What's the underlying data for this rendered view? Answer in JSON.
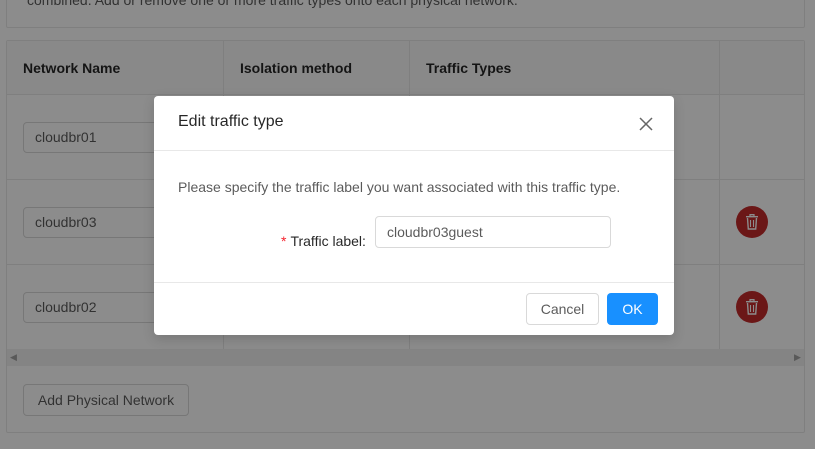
{
  "background": {
    "description": "combined. Add or remove one or more traffic types onto each physical network.",
    "table": {
      "headers": [
        "Network Name",
        "Isolation method",
        "Traffic Types",
        ""
      ],
      "rows": [
        {
          "network_name": "cloudbr01",
          "deletable": false
        },
        {
          "network_name": "cloudbr03",
          "deletable": true
        },
        {
          "network_name": "cloudbr02",
          "deletable": true
        }
      ]
    },
    "add_button_label": "Add Physical Network"
  },
  "modal": {
    "title": "Edit traffic type",
    "description": "Please specify the traffic label you want associated with this traffic type.",
    "field_required_mark": "*",
    "field_label": "Traffic label",
    "field_colon": ":",
    "field_value": "cloudbr03guest",
    "cancel_label": "Cancel",
    "ok_label": "OK"
  },
  "icons": {
    "close": "close-icon",
    "delete": "trash-icon",
    "scroll_left": "caret-left-icon",
    "scroll_right": "caret-right-icon"
  },
  "colors": {
    "primary": "#1890ff",
    "danger": "#c42b2b",
    "required": "#f5222d"
  }
}
